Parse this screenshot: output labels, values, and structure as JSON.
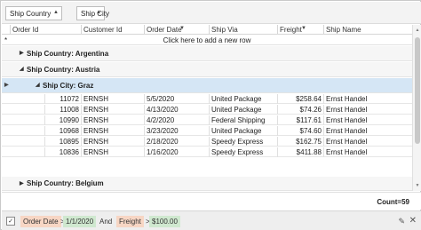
{
  "group_panel": {
    "chips": [
      {
        "label": "Ship Country"
      },
      {
        "label": "Ship City"
      }
    ]
  },
  "columns": [
    "Order Id",
    "Customer Id",
    "Order Date",
    "Ship Via",
    "Freight",
    "Ship Name"
  ],
  "new_row_text": "Click here to add a new row",
  "groups": {
    "argentina": "Ship Country: Argentina",
    "austria": "Ship Country: Austria",
    "graz": "Ship City: Graz",
    "belgium": "Ship Country: Belgium"
  },
  "rows": [
    {
      "order_id": "11072",
      "customer_id": "ERNSH",
      "order_date": "5/5/2020",
      "ship_via": "United Package",
      "freight": "$258.64",
      "ship_name": "Ernst Handel"
    },
    {
      "order_id": "11008",
      "customer_id": "ERNSH",
      "order_date": "4/13/2020",
      "ship_via": "United Package",
      "freight": "$74.26",
      "ship_name": "Ernst Handel"
    },
    {
      "order_id": "10990",
      "customer_id": "ERNSH",
      "order_date": "4/2/2020",
      "ship_via": "Federal Shipping",
      "freight": "$117.61",
      "ship_name": "Ernst Handel"
    },
    {
      "order_id": "10968",
      "customer_id": "ERNSH",
      "order_date": "3/23/2020",
      "ship_via": "United Package",
      "freight": "$74.60",
      "ship_name": "Ernst Handel"
    },
    {
      "order_id": "10895",
      "customer_id": "ERNSH",
      "order_date": "2/18/2020",
      "ship_via": "Speedy Express",
      "freight": "$162.75",
      "ship_name": "Ernst Handel"
    },
    {
      "order_id": "10836",
      "customer_id": "ERNSH",
      "order_date": "1/16/2020",
      "ship_via": "Speedy Express",
      "freight": "$411.88",
      "ship_name": "Ernst Handel"
    }
  ],
  "summary": {
    "count": "Count=59"
  },
  "filter": {
    "field1": "Order Date",
    "op1": ">",
    "value1": "1/1/2020",
    "and": "And",
    "field2": "Freight",
    "op2": ">",
    "value2": "$100.00"
  }
}
